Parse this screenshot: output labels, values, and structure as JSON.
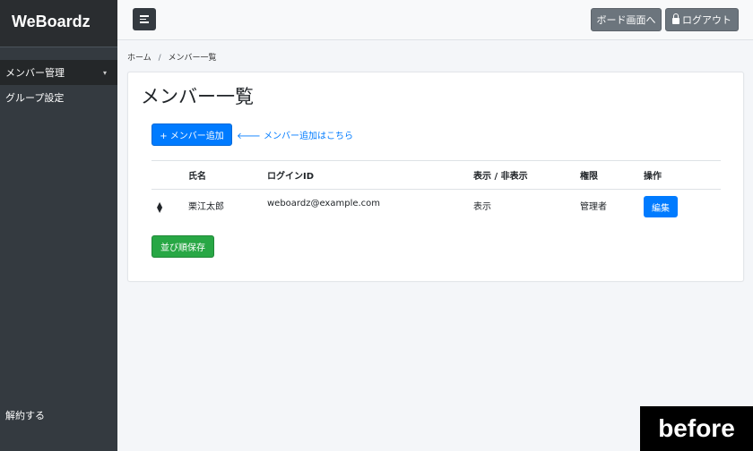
{
  "sidebar": {
    "brand": "WeBoardz",
    "items": [
      {
        "label": "メンバー管理",
        "caret": "▾"
      },
      {
        "label": "グループ設定"
      }
    ],
    "logout": "解約する"
  },
  "topbar": {
    "board_label": "ボード画面へ",
    "logout_label": "ログアウト"
  },
  "breadcrumb": {
    "home": "ホーム",
    "separator": "/",
    "current": "メンバー一覧"
  },
  "main": {
    "title": "メンバー一覧",
    "add_button": "+ メンバー追加",
    "add_hint": "🡐 メンバー追加はこちら",
    "table": {
      "headers": [
        "",
        "氏名",
        "ログインID",
        "表示 / 非表示",
        "権限",
        "操作"
      ],
      "rows": [
        {
          "name": "栗江太郎",
          "login_id": "weboardz@example.com",
          "visibility": "表示",
          "role": "管理者",
          "action": "編集"
        }
      ]
    },
    "save_button": "並び順保存"
  },
  "badge": "before",
  "colors": {
    "sidebar": "#343a40",
    "primary": "#007bff",
    "success": "#28a745",
    "secondary": "#6c757d"
  }
}
